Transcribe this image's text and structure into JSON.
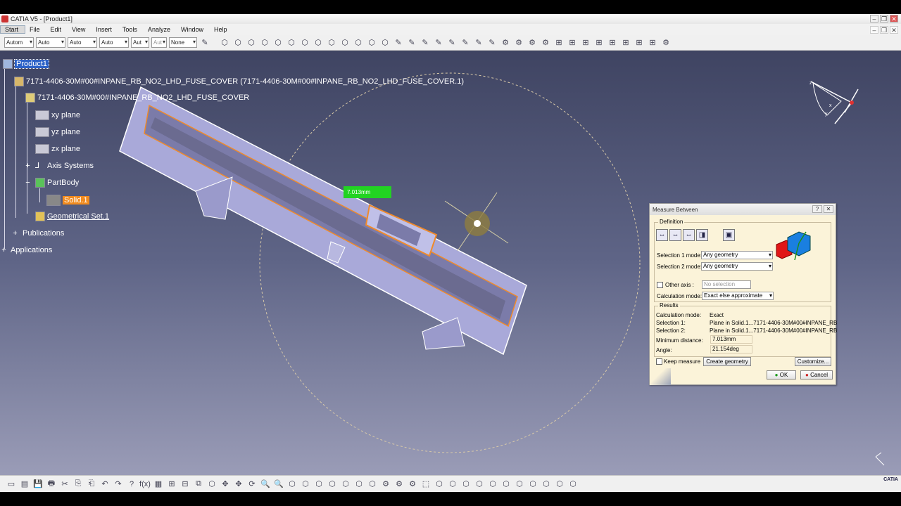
{
  "window": {
    "title": "CATIA V5 - [Product1]",
    "minimize": "–",
    "restore": "❐",
    "close": "✕"
  },
  "menu": {
    "items": [
      {
        "label": "Start"
      },
      {
        "label": "File"
      },
      {
        "label": "Edit"
      },
      {
        "label": "View"
      },
      {
        "label": "Insert"
      },
      {
        "label": "Tools"
      },
      {
        "label": "Analyze"
      },
      {
        "label": "Window"
      },
      {
        "label": "Help"
      }
    ],
    "doc_minimize": "–",
    "doc_restore": "❐",
    "doc_close": "✕"
  },
  "toolbar_top": {
    "combos": [
      {
        "value": "Autom"
      },
      {
        "value": "Auto"
      },
      {
        "value": "Auto"
      },
      {
        "value": "Auto"
      },
      {
        "value": "Aut"
      },
      {
        "value": "Aut"
      },
      {
        "value": "None"
      }
    ],
    "icon_glyphs": [
      "⬡",
      "⬡",
      "⬡",
      "⬡",
      "⬡",
      "⬡",
      "⬡",
      "⬡",
      "⬡",
      "⬡",
      "⬡",
      "⬡",
      "⬡",
      "✎",
      "✎",
      "✎",
      "✎",
      "✎",
      "✎",
      "✎",
      "✎",
      "⚙",
      "⚙",
      "⚙",
      "⚙",
      "⊞",
      "⊞",
      "⊞",
      "⊞",
      "⊞",
      "⊞",
      "⊞",
      "⊞",
      "⚙"
    ]
  },
  "tree": {
    "root": "Product1",
    "component": "7171-4406-30M#00#INPANE_RB_NO2_LHD_FUSE_COVER (7171-4406-30M#00#INPANE_RB_NO2_LHD_FUSE_COVER.1)",
    "part": "7171-4406-30M#00#INPANE_RB_NO2_LHD_FUSE_COVER",
    "xy_plane": "xy plane",
    "yz_plane": "yz plane",
    "zx_plane": "zx plane",
    "axis_systems": "Axis Systems",
    "part_body": "PartBody",
    "solid": "Solid.1",
    "geometrical_set": "Geometrical Set.1",
    "publications": "Publications",
    "applications": "Applications"
  },
  "measure_label": "7.013mm",
  "dialog": {
    "title": "Measure Between",
    "help": "?",
    "close": "✕",
    "definition_label": "Definition",
    "selection1_label": "Selection 1 mode:",
    "selection1_value": "Any geometry",
    "selection2_label": "Selection 2 mode:",
    "selection2_value": "Any geometry",
    "other_axis_label": "Other axis :",
    "other_axis_value": "No selection",
    "calc_mode_label": "Calculation mode:",
    "calc_mode_value": "Exact else approximate",
    "results_label": "Results",
    "res_calc_mode_label": "Calculation mode:",
    "res_calc_mode_value": "Exact",
    "res_sel1_label": "Selection 1:",
    "res_sel1_value": "Plane in Solid.1...7171-4406-30M#00#INPANE_RB",
    "res_sel2_label": "Selection 2:",
    "res_sel2_value": "Plane in Solid.1...7171-4406-30M#00#INPANE_RB",
    "min_dist_label": "Minimum distance:",
    "min_dist_value": "7.013mm",
    "angle_label": "Angle:",
    "angle_value": "21.154deg",
    "keep_measure_label": "Keep measure",
    "create_geometry_label": "Create geometry",
    "customize_label": "Customize...",
    "ok_label": "OK",
    "cancel_label": "Cancel"
  },
  "compass_labels": {
    "x": "x",
    "y": "y",
    "z": "z"
  },
  "toolbar_bottom": {
    "icon_glyphs": [
      "▭",
      "▤",
      "💾",
      "🖶",
      "✂",
      "⎘",
      "⎗",
      "↶",
      "↷",
      "?",
      "f(x)",
      "▦",
      "⊞",
      "⊟",
      "⧉",
      "⬡",
      "✥",
      "✥",
      "⟳",
      "🔍",
      "🔍",
      "⬡",
      "⬡",
      "⬡",
      "⬡",
      "⬡",
      "⬡",
      "⬡",
      "⚙",
      "⚙",
      "⚙",
      "⬚",
      "⬡",
      "⬡",
      "⬡",
      "⬡",
      "⬡",
      "⬡",
      "⬡",
      "⬡",
      "⬡",
      "⬡",
      "⬡"
    ],
    "logo": "CATIA"
  }
}
